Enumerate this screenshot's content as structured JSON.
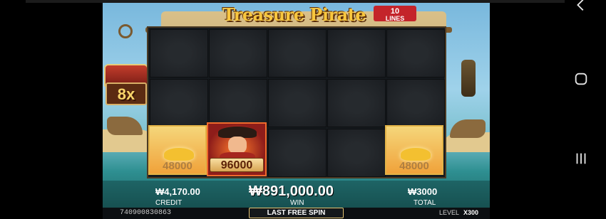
{
  "game": {
    "logo_text": "Treasure Pirate",
    "lines_count": "10",
    "lines_label": "LINES",
    "multiplier": "8x"
  },
  "reels": {
    "gold_left_value": "48000",
    "pirate_value": "96000",
    "gold_right_value": "48000"
  },
  "hud": {
    "credit_value": "₩4,170.00",
    "credit_label": "CREDIT",
    "win_value": "₩891,000.00",
    "win_label": "WIN",
    "total_value": "₩3000",
    "total_label": "TOTAL"
  },
  "footer": {
    "game_id": "740900830863",
    "spin_label": "LAST FREE SPIN",
    "level_label": "LEVEL",
    "level_value": "X300"
  },
  "icons": [
    "back-icon",
    "home-icon",
    "recent-apps-icon",
    "skull-icon",
    "gold-coins-icon",
    "lantern-icon",
    "chest-icon"
  ]
}
